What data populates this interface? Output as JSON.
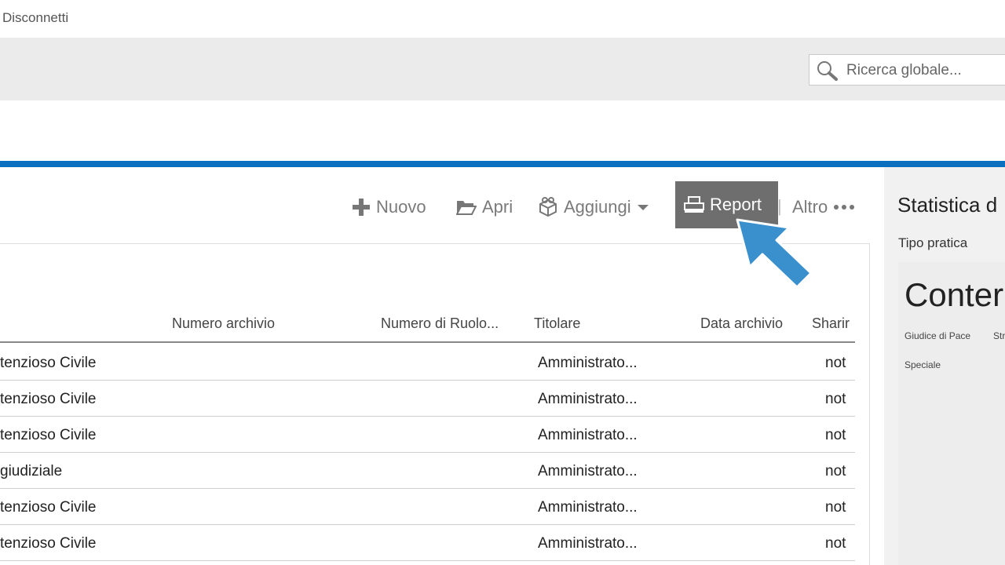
{
  "header": {
    "disconnect_label": "Disconnetti"
  },
  "search": {
    "placeholder": "Ricerca globale..."
  },
  "toolbar": {
    "new_label": "Nuovo",
    "open_label": "Apri",
    "add_label": "Aggiungi",
    "report_label": "Report",
    "separator": "|",
    "more_label": "Altro"
  },
  "table": {
    "columns": [
      "Numero archivio",
      "Numero di Ruolo...",
      "Titolare",
      "Data archivio",
      "Sharir"
    ],
    "rows": [
      {
        "tipo": "tenzioso Civile",
        "titolare": "Amministrato...",
        "sharing": "not"
      },
      {
        "tipo": "tenzioso Civile",
        "titolare": "Amministrato...",
        "sharing": "not"
      },
      {
        "tipo": "tenzioso Civile",
        "titolare": "Amministrato...",
        "sharing": "not"
      },
      {
        "tipo": "giudiziale",
        "titolare": "Amministrato...",
        "sharing": "not"
      },
      {
        "tipo": "tenzioso Civile",
        "titolare": "Amministrato...",
        "sharing": "not"
      },
      {
        "tipo": "tenzioso Civile",
        "titolare": "Amministrato...",
        "sharing": "not"
      }
    ]
  },
  "stats": {
    "title": "Statistica d",
    "tipo_label": "Tipo pratica",
    "big_label": "Conter",
    "tags": [
      "Giudice di Pace",
      "Str",
      "Speciale"
    ]
  },
  "colors": {
    "accent_blue": "#0a6fbe",
    "report_bg": "#6e6e6e",
    "cursor_blue": "#3a8fcd"
  }
}
